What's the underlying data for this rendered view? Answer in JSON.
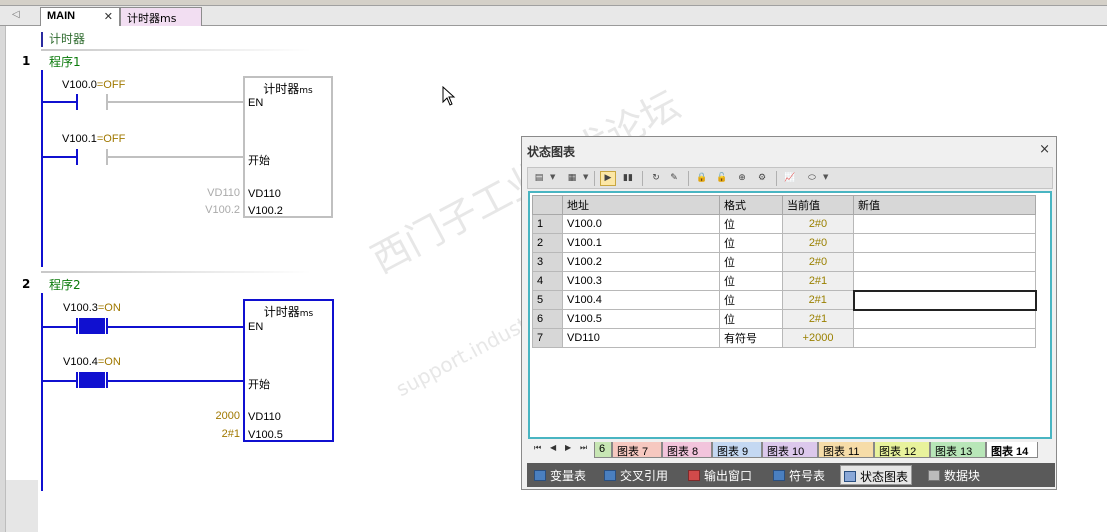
{
  "editor": {
    "tabs": [
      {
        "label": "MAIN",
        "close": "✕"
      },
      {
        "label": "计时器ms"
      }
    ],
    "pou_title": "计时器",
    "networks": [
      {
        "number": "1",
        "title": "程序1",
        "contact1": {
          "address": "V100.0",
          "state": "=OFF"
        },
        "contact2": {
          "address": "V100.1",
          "state": "=OFF"
        },
        "box": {
          "title": "计时器",
          "title_suffix": "ms",
          "pin_en": "EN",
          "pin_start": "开始",
          "pin_vd": "VD110",
          "pin_bit": "V100.2",
          "in_vd": "VD110",
          "in_bit": "V100.2"
        }
      },
      {
        "number": "2",
        "title": "程序2",
        "contact1": {
          "address": "V100.3",
          "state": "=ON"
        },
        "contact2": {
          "address": "V100.4",
          "state": "=ON"
        },
        "box": {
          "title": "计时器",
          "title_suffix": "ms",
          "pin_en": "EN",
          "pin_start": "开始",
          "pin_vd": "VD110",
          "pin_bit": "V100.5",
          "in_vd": "2000",
          "in_bit": "2#1"
        }
      }
    ],
    "colors": {
      "inactive": "#c0c0c0",
      "active": "#1010d0",
      "value": "#a07800"
    }
  },
  "watermark": {
    "line1": "西门子工业技术论坛",
    "line2": "support.industry.siemens.com/cs"
  },
  "status_chart": {
    "title": "状态图表",
    "close": "×",
    "columns": [
      "",
      "地址",
      "格式",
      "当前值",
      "新值"
    ],
    "rows": [
      {
        "n": "1",
        "address": "V100.0",
        "format": "位",
        "current": "2#0",
        "new": ""
      },
      {
        "n": "2",
        "address": "V100.1",
        "format": "位",
        "current": "2#0",
        "new": ""
      },
      {
        "n": "3",
        "address": "V100.2",
        "format": "位",
        "current": "2#0",
        "new": ""
      },
      {
        "n": "4",
        "address": "V100.3",
        "format": "位",
        "current": "2#1",
        "new": ""
      },
      {
        "n": "5",
        "address": "V100.4",
        "format": "位",
        "current": "2#1",
        "new": ""
      },
      {
        "n": "6",
        "address": "V100.5",
        "format": "位",
        "current": "2#1",
        "new": ""
      },
      {
        "n": "7",
        "address": "VD110",
        "format": "有符号",
        "current": "+2000",
        "new": ""
      }
    ],
    "sheet_tabs": [
      {
        "label": "6",
        "color": "#c8e6b4"
      },
      {
        "label": "图表 7",
        "color": "#f6c8c0"
      },
      {
        "label": "图表 8",
        "color": "#f2c4dc"
      },
      {
        "label": "图表 9",
        "color": "#c4d8f2"
      },
      {
        "label": "图表 10",
        "color": "#dcc8ec"
      },
      {
        "label": "图表 11",
        "color": "#f6dca8"
      },
      {
        "label": "图表 12",
        "color": "#e8f29c"
      },
      {
        "label": "图表 13",
        "color": "#b8e6b8"
      },
      {
        "label": "图表 14",
        "color": "#ffffff"
      }
    ],
    "bottom_tabs": [
      "变量表",
      "交叉引用",
      "输出窗口",
      "符号表",
      "状态图表",
      "数据块"
    ],
    "selected_bottom_tab": "状态图表"
  }
}
